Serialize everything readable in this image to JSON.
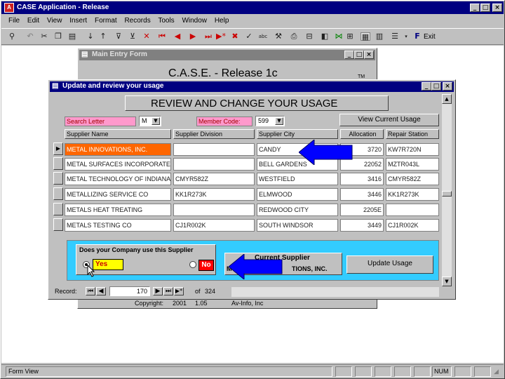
{
  "app": {
    "title": "CASE Application - Release",
    "menu": [
      "File",
      "Edit",
      "View",
      "Insert",
      "Format",
      "Records",
      "Tools",
      "Window",
      "Help"
    ],
    "toolbar_exit_label": "Exit"
  },
  "main_form": {
    "title": "Main Entry Form",
    "heading": "C.A.S.E. - Release 1c",
    "tm": "TM",
    "copyright_label": "Copyright:",
    "copyright_year": "2001",
    "version": "1.05",
    "company": "Av-Info, Inc"
  },
  "usage_form": {
    "title": "Update and review your usage",
    "heading": "REVIEW AND CHANGE YOUR USAGE",
    "search_letter_label": "Search Letter",
    "search_letter_value": "M",
    "member_code_label": "Member Code:",
    "member_code_value": "599",
    "view_current_usage_label": "View Current Usage",
    "columns": {
      "supplier_name": "Supplier Name",
      "supplier_division": "Supplier Division",
      "supplier_city": "Supplier City",
      "allocation": "Allocation",
      "repair_station": "Repair Station"
    },
    "rows": [
      {
        "name": "METAL INNOVATIONS, INC.",
        "division": "",
        "city": "CANDY",
        "allocation": "3720",
        "repair": "KW7R720N"
      },
      {
        "name": "METAL SURFACES INCORPORATE",
        "division": "",
        "city": "BELL GARDENS",
        "allocation": "22052",
        "repair": "MZTR043L"
      },
      {
        "name": "METAL TECHNOLOGY OF INDIANA",
        "division": "CMYR582Z",
        "city": "WESTFIELD",
        "allocation": "3416",
        "repair": "CMYR582Z"
      },
      {
        "name": "METALLIZING SERVICE CO",
        "division": "KK1R273K",
        "city": "ELMWOOD",
        "allocation": "3446",
        "repair": "KK1R273K"
      },
      {
        "name": "METALS HEAT TREATING",
        "division": "",
        "city": "REDWOOD CITY",
        "allocation": "2205E",
        "repair": ""
      },
      {
        "name": "METALS TESTING CO",
        "division": "CJ1R002K",
        "city": "SOUTH WINDSOR",
        "allocation": "3449",
        "repair": "CJ1R002K"
      }
    ],
    "question": "Does your Company use this Supplier",
    "yes_label": "Yes",
    "no_label": "No",
    "current_supplier_label": "Current Supplier",
    "current_supplier_value": "METAL INNOVATIONS, INC.",
    "current_supplier_visible": "TIONS, INC.",
    "current_supplier_prefix": "M",
    "update_usage_label": "Update Usage",
    "record_label": "Record:",
    "record_number": "170",
    "record_of": "of",
    "record_total": "324"
  },
  "status_bar": {
    "text": "Form View",
    "num": "NUM"
  },
  "colors": {
    "title_active": "#000080",
    "title_inactive": "#808080",
    "search_label_bg": "#ff99cc",
    "selected_row_bg": "#ff6600",
    "panel_bg": "#33ccff",
    "yes_bg": "#ffff00",
    "no_bg": "#ff0000",
    "arrow": "#0000ff"
  },
  "icons": [
    "binoculars-icon",
    "undo-icon",
    "cut-icon",
    "copy-icon",
    "paste-icon",
    "sort-asc-icon",
    "sort-desc-icon",
    "filter-icon",
    "first-record-icon",
    "prev-record-icon",
    "next-record-icon",
    "last-record-icon",
    "new-record-icon",
    "delete-record-icon",
    "spell-icon",
    "tools-icon",
    "print-icon",
    "preview-icon",
    "save-icon",
    "chart-icon",
    "form-view-icon",
    "datasheet-icon",
    "grid-icon",
    "font-icon"
  ]
}
